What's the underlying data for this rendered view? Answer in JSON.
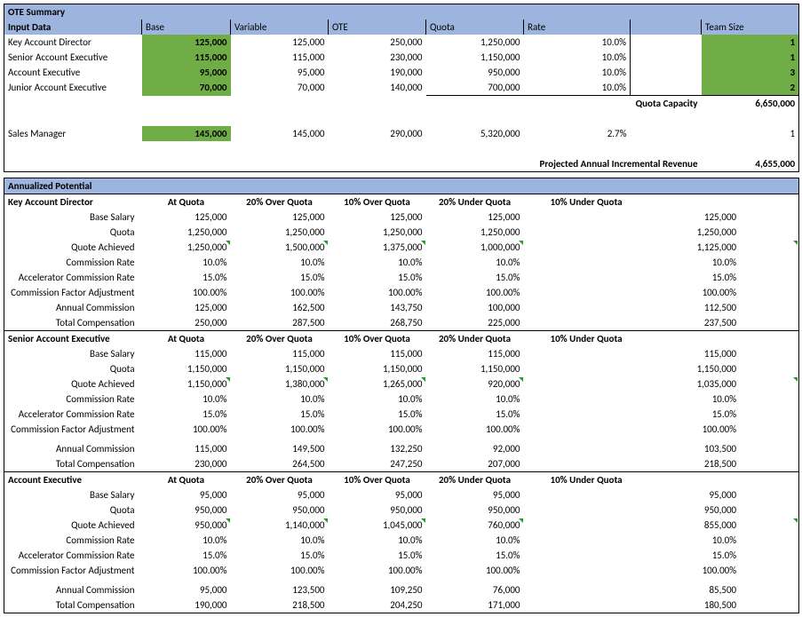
{
  "ote": {
    "title": "OTE Summary",
    "headers": {
      "c0": "Input Data",
      "c1": "Base",
      "c2": "Variable",
      "c3": "OTE",
      "c4": "Quota",
      "c5": "Rate",
      "c7": "Team Size"
    },
    "rows": [
      {
        "role": "Key Account Director",
        "base": "125,000",
        "variable": "125,000",
        "ote": "250,000",
        "quota": "1,250,000",
        "rate": "10.0%",
        "team": "1"
      },
      {
        "role": "Senior Account Executive",
        "base": "115,000",
        "variable": "115,000",
        "ote": "230,000",
        "quota": "1,150,000",
        "rate": "10.0%",
        "team": "1"
      },
      {
        "role": "Account Executive",
        "base": "95,000",
        "variable": "95,000",
        "ote": "190,000",
        "quota": "950,000",
        "rate": "10.0%",
        "team": "3"
      },
      {
        "role": "Junior Account Executive",
        "base": "70,000",
        "variable": "70,000",
        "ote": "140,000",
        "quota": "700,000",
        "rate": "10.0%",
        "team": "2"
      }
    ],
    "quota_capacity_label": "Quota Capacity",
    "quota_capacity": "6,650,000",
    "manager": {
      "role": "Sales Manager",
      "base": "145,000",
      "variable": "145,000",
      "ote": "290,000",
      "quota": "5,320,000",
      "rate": "2.7%",
      "team": "1"
    },
    "projected_label": "Projected Annual Incremental Revenue",
    "projected_value": "4,655,000"
  },
  "ap": {
    "title": "Annualized Potential",
    "col_headers": [
      "At Quota",
      "20% Over Quota",
      "10% Over Quota",
      "20% Under Quota",
      "10% Under Quota"
    ],
    "row_labels": [
      "Base Salary",
      "Quota",
      "Quote Achieved",
      "Commission Rate",
      "Accelerator Commission Rate",
      "Commission Factor Adjustment",
      "Annual Commission",
      "Total Compensation"
    ],
    "roles": [
      {
        "name": "Key Account Director",
        "rows": [
          [
            "125,000",
            "125,000",
            "125,000",
            "125,000",
            "125,000"
          ],
          [
            "1,250,000",
            "1,250,000",
            "1,250,000",
            "1,250,000",
            "1,250,000"
          ],
          [
            "1,250,000",
            "1,500,000",
            "1,375,000",
            "1,000,000",
            "1,125,000"
          ],
          [
            "10.0%",
            "10.0%",
            "10.0%",
            "10.0%",
            "10.0%"
          ],
          [
            "15.0%",
            "15.0%",
            "15.0%",
            "15.0%",
            "15.0%"
          ],
          [
            "100.00%",
            "100.00%",
            "100.00%",
            "100.00%",
            "100.00%"
          ],
          [
            "125,000",
            "162,500",
            "143,750",
            "100,000",
            "112,500"
          ],
          [
            "250,000",
            "287,500",
            "268,750",
            "225,000",
            "237,500"
          ]
        ]
      },
      {
        "name": "Senior Account Executive",
        "rows": [
          [
            "115,000",
            "115,000",
            "115,000",
            "115,000",
            "115,000"
          ],
          [
            "1,150,000",
            "1,150,000",
            "1,150,000",
            "1,150,000",
            "1,150,000"
          ],
          [
            "1,150,000",
            "1,380,000",
            "1,265,000",
            "920,000",
            "1,035,000"
          ],
          [
            "10.0%",
            "10.0%",
            "10.0%",
            "10.0%",
            "10.0%"
          ],
          [
            "15.0%",
            "15.0%",
            "15.0%",
            "15.0%",
            "15.0%"
          ],
          [
            "100.00%",
            "100.00%",
            "100.00%",
            "100.00%",
            "100.00%"
          ],
          [
            "115,000",
            "149,500",
            "132,250",
            "92,000",
            "103,500"
          ],
          [
            "230,000",
            "264,500",
            "247,250",
            "207,000",
            "218,500"
          ]
        ]
      },
      {
        "name": "Account Executive",
        "rows": [
          [
            "95,000",
            "95,000",
            "95,000",
            "95,000",
            "95,000"
          ],
          [
            "950,000",
            "950,000",
            "950,000",
            "950,000",
            "950,000"
          ],
          [
            "950,000",
            "1,140,000",
            "1,045,000",
            "760,000",
            "855,000"
          ],
          [
            "10.0%",
            "10.0%",
            "10.0%",
            "10.0%",
            "10.0%"
          ],
          [
            "15.0%",
            "15.0%",
            "15.0%",
            "15.0%",
            "15.0%"
          ],
          [
            "100.00%",
            "100.00%",
            "100.00%",
            "100.00%",
            "100.00%"
          ],
          [
            "95,000",
            "123,500",
            "109,250",
            "76,000",
            "85,500"
          ],
          [
            "190,000",
            "218,500",
            "204,250",
            "171,000",
            "180,500"
          ]
        ]
      }
    ]
  }
}
